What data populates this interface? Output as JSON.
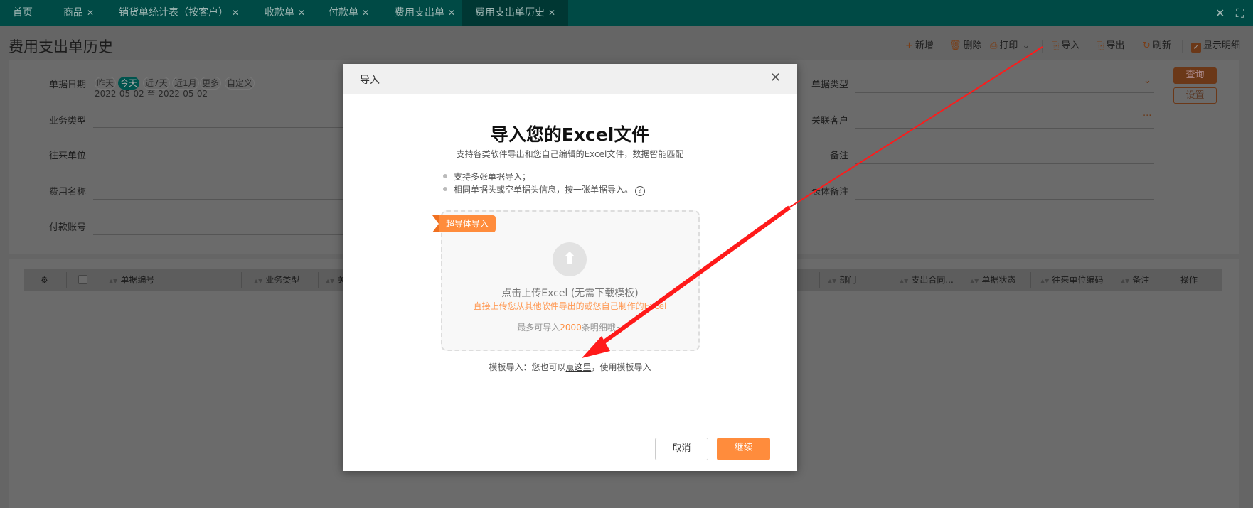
{
  "tabs": [
    {
      "label": "首页",
      "closable": false
    },
    {
      "label": "商品",
      "closable": true
    },
    {
      "label": "销货单统计表（按客户）",
      "closable": true
    },
    {
      "label": "收款单",
      "closable": true
    },
    {
      "label": "付款单",
      "closable": true
    },
    {
      "label": "费用支出单",
      "closable": true
    },
    {
      "label": "费用支出单历史",
      "closable": true,
      "active": true
    }
  ],
  "close_glyph": "✕",
  "page_title": "费用支出单历史",
  "toolbar": {
    "new": "新增",
    "delete": "删除",
    "print": "打印",
    "import": "导入",
    "export": "导出",
    "refresh": "刷新",
    "show_detail": "显示明细",
    "show_detail_checked": true
  },
  "filter": {
    "date_label": "单据日期",
    "quick": [
      "昨天",
      "今天",
      "近7天",
      "近1月",
      "更多",
      "自定义"
    ],
    "quick_selected": "今天",
    "date_range": "2022-05-02 至 2022-05-02",
    "left_labels": [
      "业务类型",
      "往来单位",
      "费用名称",
      "付款账号"
    ],
    "right_labels": [
      "单据类型",
      "关联客户",
      "备注",
      "表体备注"
    ],
    "query": "查询",
    "settings": "设置"
  },
  "table": {
    "columns": [
      "单据编号",
      "业务类型",
      "关",
      "部门",
      "支出合同...",
      "单据状态",
      "往来单位编码",
      "备注"
    ],
    "actions": "操作"
  },
  "modal": {
    "title": "导入",
    "heading": "导入您的Excel文件",
    "subtitle": "支持各类软件导出和您自己编辑的Excel文件，数据智能匹配",
    "bullets": [
      "支持多张单据导入；",
      "相同单据头或空单据头信息，按一张单据导入。"
    ],
    "ribbon": "超导体导入",
    "upload_main": "点击上传Excel (无需下载模板)",
    "upload_sub": "直接上传您从其他软件导出的或您自己制作的Excel",
    "limit_prefix": "最多可导入",
    "limit_count": "2000",
    "limit_suffix": "条明细哦~",
    "tpl_prefix": "模板导入：您也可以",
    "tpl_link": "点这里",
    "tpl_suffix": "，使用模板导入",
    "cancel": "取消",
    "continue": "继续"
  },
  "colors": {
    "accent": "#ff8c3c",
    "annotation_arrow": "#ff1a1a",
    "tabbar": "#004a45"
  }
}
